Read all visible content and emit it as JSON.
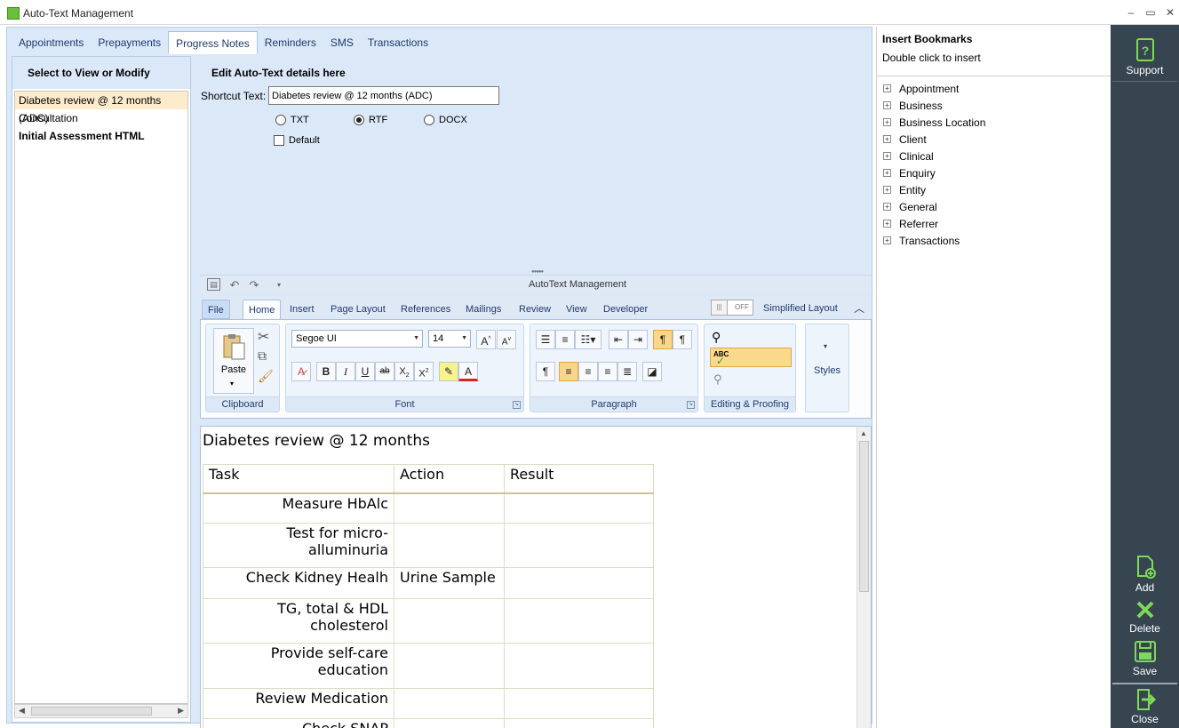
{
  "window": {
    "title": "Auto-Text Management",
    "controls": {
      "minimize": "‒",
      "maximize": "▭",
      "close": "✕"
    }
  },
  "tabs": [
    {
      "label": "Appointments"
    },
    {
      "label": "Prepayments"
    },
    {
      "label": "Progress Notes",
      "active": true
    },
    {
      "label": "Reminders"
    },
    {
      "label": "SMS"
    },
    {
      "label": "Transactions"
    }
  ],
  "list": {
    "header": "Select to View or Modify",
    "items": [
      {
        "label": "Diabetes review @ 12 months (ADC)",
        "selected": true
      },
      {
        "label": "Consultation"
      },
      {
        "label": "Initial Assessment HTML",
        "bold": true
      }
    ]
  },
  "edit": {
    "header": "Edit Auto-Text details here",
    "shortcut_label": "Shortcut Text:",
    "shortcut_value": "Diabetes review @ 12 months (ADC)",
    "formats": [
      {
        "label": "TXT",
        "selected": false
      },
      {
        "label": "RTF",
        "selected": true
      },
      {
        "label": "DOCX",
        "selected": false
      }
    ],
    "default_label": "Default",
    "default_checked": false
  },
  "editor": {
    "qat_title": "AutoText Management",
    "ribbon_tabs": [
      "File",
      "Home",
      "Insert",
      "Page Layout",
      "References",
      "Mailings",
      "Review",
      "View",
      "Developer"
    ],
    "active_tab": "Home",
    "toggle_label": "OFF",
    "simplified_layout_label": "Simplified Layout",
    "groups": {
      "clipboard": "Clipboard",
      "font": "Font",
      "paragraph": "Paragraph",
      "editing": "Editing & Proofing",
      "styles": "Styles"
    },
    "paste_label": "Paste",
    "font_name": "Segoe UI",
    "font_size": "14",
    "spell_label": "ABC"
  },
  "document": {
    "title": "Diabetes review @ 12 months",
    "columns": [
      "Task",
      "Action",
      "Result"
    ],
    "rows": [
      {
        "task": "Measure HbAlc",
        "action": "",
        "result": ""
      },
      {
        "task": "Test for micro-alluminuria",
        "action": "",
        "result": ""
      },
      {
        "task": "Check Kidney Healh",
        "action": "Urine Sample",
        "result": ""
      },
      {
        "task": "TG, total & HDL cholesterol",
        "action": "",
        "result": ""
      },
      {
        "task": "Provide self-care education",
        "action": "",
        "result": ""
      },
      {
        "task": "Review Medication",
        "action": "",
        "result": ""
      },
      {
        "task": "Check SNAP",
        "action": "",
        "result": ""
      }
    ]
  },
  "bookmarks": {
    "title": "Insert Bookmarks",
    "subtitle": "Double click to insert",
    "nodes": [
      "Appointment",
      "Business",
      "Business Location",
      "Client",
      "Clinical",
      "Enquiry",
      "Entity",
      "General",
      "Referrer",
      "Transactions"
    ]
  },
  "sidebar": {
    "support": "Support",
    "add": "Add",
    "delete": "Delete",
    "save": "Save",
    "close": "Close",
    "accent_color": "#7ed957"
  }
}
